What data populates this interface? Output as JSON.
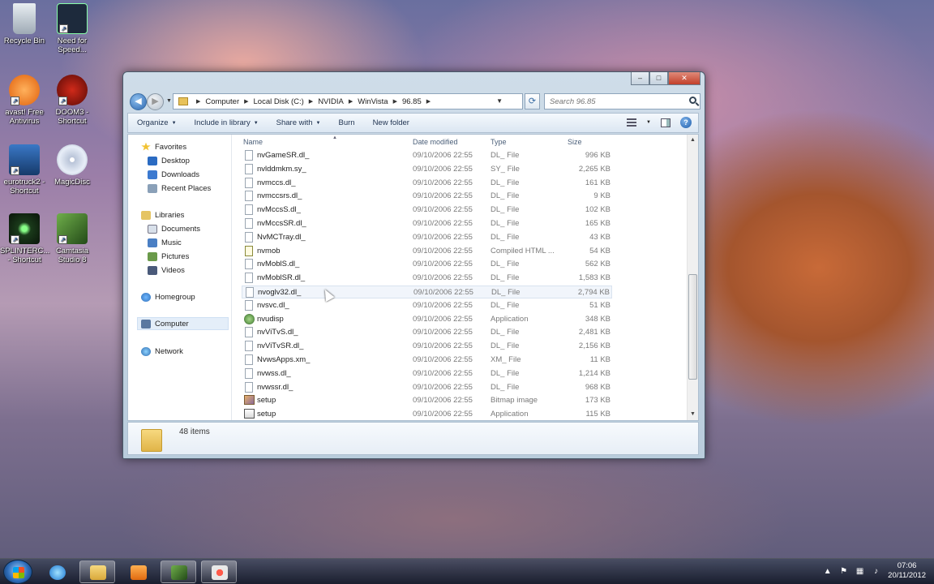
{
  "desktop": {
    "icons": [
      {
        "label": "Recycle Bin",
        "color": "#c9d4dd"
      },
      {
        "label": "Need for Speed...",
        "color": "#1d2a3c"
      },
      {
        "label": "avast! Free Antivirus",
        "color": "#f07a1a"
      },
      {
        "label": "DOOM3 - Shortcut",
        "color": "#a31812"
      },
      {
        "label": "eurotruck2 - Shortcut",
        "color": "#1f4f8a"
      },
      {
        "label": "MagicDisc",
        "color": "#b9c4d8"
      },
      {
        "label": "SPLINTERC... - Shortcut",
        "color": "#2a5a2a"
      },
      {
        "label": "Camtasia Studio 8",
        "color": "#3b6a2e"
      }
    ]
  },
  "window": {
    "caption": {
      "minimize": "–",
      "maximize": "□",
      "close": "✕"
    },
    "address": {
      "crumbs": [
        "Computer",
        "Local Disk (C:)",
        "NVIDIA",
        "WinVista",
        "96.85"
      ]
    },
    "search": {
      "placeholder": "Search 96.85"
    },
    "toolbar": {
      "organize": "Organize",
      "include": "Include in library",
      "share": "Share with",
      "burn": "Burn",
      "new_folder": "New folder",
      "help": "?"
    },
    "nav": {
      "favorites": "Favorites",
      "desktop": "Desktop",
      "downloads": "Downloads",
      "recent": "Recent Places",
      "libraries": "Libraries",
      "documents": "Documents",
      "music": "Music",
      "pictures": "Pictures",
      "videos": "Videos",
      "homegroup": "Homegroup",
      "computer": "Computer",
      "network": "Network"
    },
    "columns": {
      "name": "Name",
      "date": "Date modified",
      "type": "Type",
      "size": "Size"
    },
    "files": [
      {
        "name": "nvGameSR.dl_",
        "date": "09/10/2006 22:55",
        "type": "DL_ File",
        "size": "996 KB",
        "icon": "file"
      },
      {
        "name": "nvlddmkm.sy_",
        "date": "09/10/2006 22:55",
        "type": "SY_ File",
        "size": "2,265 KB",
        "icon": "file"
      },
      {
        "name": "nvmccs.dl_",
        "date": "09/10/2006 22:55",
        "type": "DL_ File",
        "size": "161 KB",
        "icon": "file"
      },
      {
        "name": "nvmccsrs.dl_",
        "date": "09/10/2006 22:55",
        "type": "DL_ File",
        "size": "9 KB",
        "icon": "file"
      },
      {
        "name": "nvMccsS.dl_",
        "date": "09/10/2006 22:55",
        "type": "DL_ File",
        "size": "102 KB",
        "icon": "file"
      },
      {
        "name": "nvMccsSR.dl_",
        "date": "09/10/2006 22:55",
        "type": "DL_ File",
        "size": "165 KB",
        "icon": "file"
      },
      {
        "name": "NvMCTray.dl_",
        "date": "09/10/2006 22:55",
        "type": "DL_ File",
        "size": "43 KB",
        "icon": "file"
      },
      {
        "name": "nvmob",
        "date": "09/10/2006 22:55",
        "type": "Compiled HTML ...",
        "size": "54 KB",
        "icon": "html"
      },
      {
        "name": "nvMoblS.dl_",
        "date": "09/10/2006 22:55",
        "type": "DL_ File",
        "size": "562 KB",
        "icon": "file"
      },
      {
        "name": "nvMoblSR.dl_",
        "date": "09/10/2006 22:55",
        "type": "DL_ File",
        "size": "1,583 KB",
        "icon": "file"
      },
      {
        "name": "nvoglv32.dl_",
        "date": "09/10/2006 22:55",
        "type": "DL_ File",
        "size": "2,794 KB",
        "icon": "file",
        "hover": true
      },
      {
        "name": "nvsvc.dl_",
        "date": "09/10/2006 22:55",
        "type": "DL_ File",
        "size": "51 KB",
        "icon": "file"
      },
      {
        "name": "nvudisp",
        "date": "09/10/2006 22:55",
        "type": "Application",
        "size": "348 KB",
        "icon": "app"
      },
      {
        "name": "nvViTvS.dl_",
        "date": "09/10/2006 22:55",
        "type": "DL_ File",
        "size": "2,481 KB",
        "icon": "file"
      },
      {
        "name": "nvViTvSR.dl_",
        "date": "09/10/2006 22:55",
        "type": "DL_ File",
        "size": "2,156 KB",
        "icon": "file"
      },
      {
        "name": "NvwsApps.xm_",
        "date": "09/10/2006 22:55",
        "type": "XM_ File",
        "size": "11 KB",
        "icon": "file"
      },
      {
        "name": "nvwss.dl_",
        "date": "09/10/2006 22:55",
        "type": "DL_ File",
        "size": "1,214 KB",
        "icon": "file"
      },
      {
        "name": "nvwssr.dl_",
        "date": "09/10/2006 22:55",
        "type": "DL_ File",
        "size": "968 KB",
        "icon": "file"
      },
      {
        "name": "setup",
        "date": "09/10/2006 22:55",
        "type": "Bitmap image",
        "size": "173 KB",
        "icon": "bmp"
      },
      {
        "name": "setup",
        "date": "09/10/2006 22:55",
        "type": "Application",
        "size": "115 KB",
        "icon": "exe2"
      }
    ],
    "status": {
      "items": "48 items"
    }
  },
  "taskbar": {
    "clock_time": "07:06",
    "clock_date": "20/11/2012",
    "tray_arrow": "▲"
  }
}
